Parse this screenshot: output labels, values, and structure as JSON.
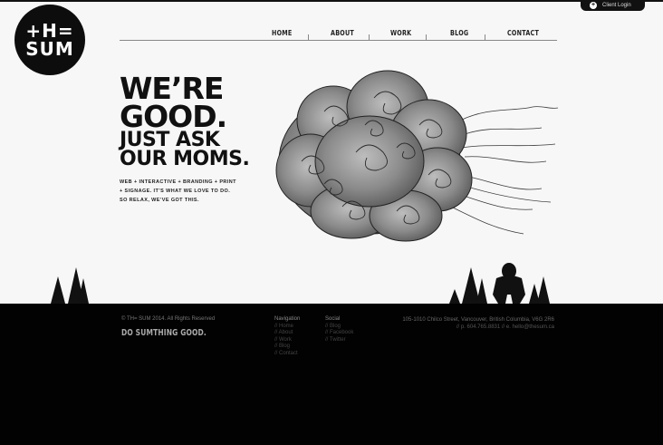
{
  "client_login": {
    "label": "Client Login"
  },
  "logo": {
    "line1": "+H=",
    "line2": "SUM"
  },
  "nav": [
    {
      "label": "HOME"
    },
    {
      "label": "ABOUT"
    },
    {
      "label": "WORK"
    },
    {
      "label": "BLOG"
    },
    {
      "label": "CONTACT"
    }
  ],
  "hero": {
    "line1": "WE’RE",
    "line2": "GOOD.",
    "line3": "JUST ASK",
    "line4": "OUR MOMS.",
    "tagline": "WEB + INTERACTIVE + BRANDING + PRINT + SIGNAGE. IT’S WHAT WE LOVE TO DO. SO RELAX, WE’VE GOT THIS."
  },
  "footer": {
    "copyright": "© TH= SUM 2014. All Rights Reserved",
    "slogan": "DO SUMTHING GOOD.",
    "navigation": {
      "heading": "Navigation",
      "links": [
        "// Home",
        "// About",
        "// Work",
        "// Blog",
        "// Contact"
      ]
    },
    "social": {
      "heading": "Social",
      "links": [
        "// Blog",
        "// Facebook",
        "// Twitter"
      ]
    },
    "address": "105-1010 Chilco Street, Vancouver, British Columbia, V6G 2R6",
    "contact": "// p. 604.765.8831 // e. hello@thesum.ca"
  },
  "colors": {
    "background": "#f7f7f7",
    "footer": "#020202",
    "text": "#111111"
  }
}
